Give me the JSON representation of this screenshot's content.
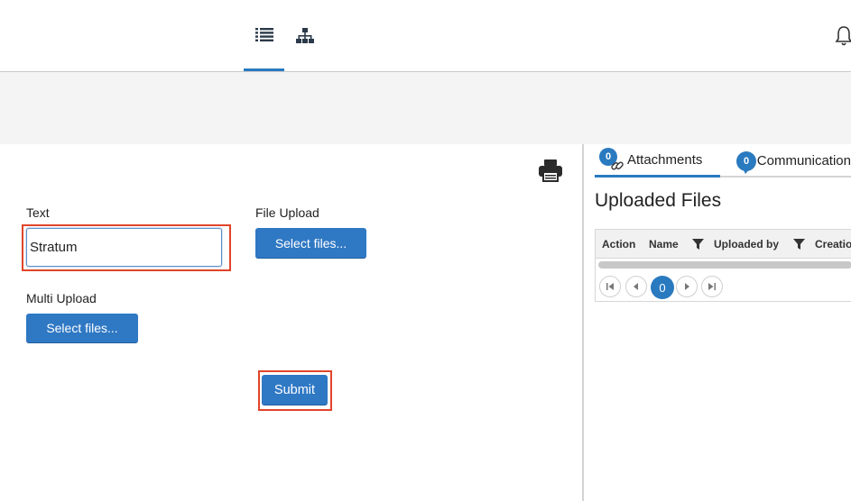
{
  "topbar": {
    "tabs": [
      {
        "icon": "list-icon",
        "active": true
      },
      {
        "icon": "hierarchy-icon",
        "active": false
      }
    ],
    "notification_icon": "bell-icon"
  },
  "form": {
    "text_label": "Text",
    "text_value": "Stratum",
    "file_upload_label": "File Upload",
    "file_upload_button": "Select files...",
    "multi_upload_label": "Multi Upload",
    "multi_upload_button": "Select files...",
    "submit_label": "Submit",
    "print_icon": "printer-icon"
  },
  "side_panel": {
    "tabs": [
      {
        "label": "Attachments",
        "count": "0",
        "active": true
      },
      {
        "label": "Communication",
        "count": "0",
        "active": false
      }
    ],
    "title": "Uploaded Files",
    "grid": {
      "columns": [
        "Action",
        "Name",
        "Uploaded by",
        "Creatio"
      ],
      "pager_page": "0"
    }
  },
  "colors": {
    "accent": "#2a7ac0",
    "button": "#2f78c4",
    "highlight": "#e0452a"
  }
}
